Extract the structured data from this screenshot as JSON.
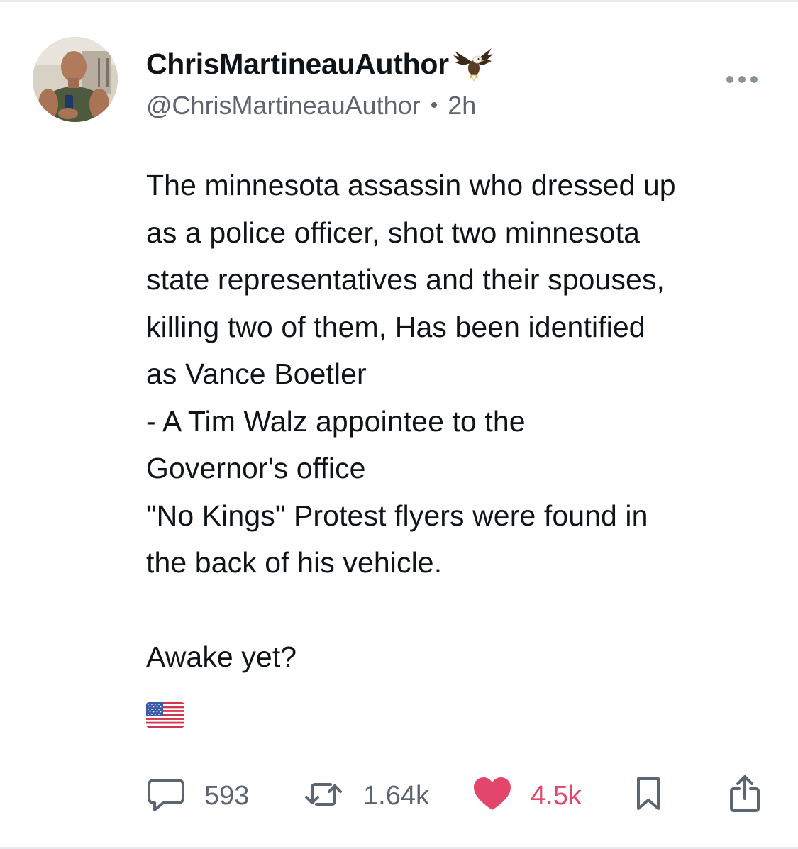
{
  "post": {
    "display_name": "ChrisMartineauAuthor",
    "display_name_emoji": "eagle-icon",
    "handle": "@ChrisMartineauAuthor",
    "separator": "•",
    "timestamp": "2h",
    "more_icon": "more-horizontal-icon",
    "body_lines": [
      "The minnesota assassin who dressed up",
      "as a police officer, shot two minnesota",
      "state representatives and their spouses,",
      "killing two of them, Has been identified",
      "as Vance Boetler",
      "- A Tim Walz appointee to the",
      "Governor's office",
      "\"No Kings\" Protest flyers were found in",
      "the back of his vehicle."
    ],
    "closing_line": "Awake yet?",
    "trailing_emoji": "us-flag-icon"
  },
  "actions": {
    "reply": {
      "icon": "reply-icon",
      "count": "593"
    },
    "repost": {
      "icon": "repost-icon",
      "count": "1.64k"
    },
    "like": {
      "icon": "heart-icon",
      "count": "4.5k",
      "active_color": "#e2466a"
    },
    "bookmark": {
      "icon": "bookmark-icon"
    },
    "share": {
      "icon": "share-icon"
    }
  },
  "colors": {
    "text_primary": "#0f1419",
    "text_secondary": "#5c6570",
    "like_active": "#e2466a",
    "divider": "#e9e9ec"
  }
}
